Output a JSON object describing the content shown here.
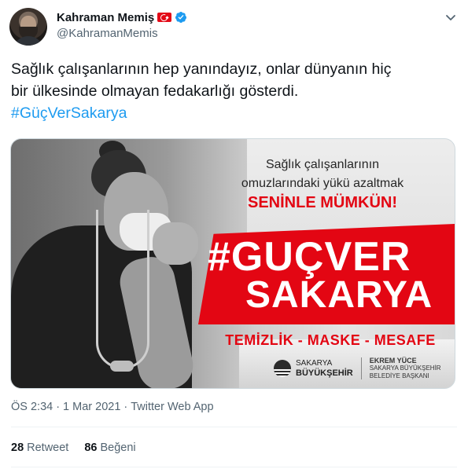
{
  "author": {
    "name": "Kahraman Memiş",
    "handle": "@KahramanMemis",
    "flag_icon": "turkey-flag-icon",
    "verified_icon": "verified-badge-icon"
  },
  "tweet": {
    "line1": "Sağlık çalışanlarının hep yanındayız, onlar dünyanın hiç",
    "line2": "bir ülkesinde olmayan fedakarlığı gösterdi.",
    "hashtag": "#GüçVerSakarya"
  },
  "media": {
    "line1": "Sağlık çalışanlarının",
    "line2": "omuzlarındaki yükü azaltmak",
    "line3": "SENİNLE MÜMKÜN!",
    "hash1": "#GUÇVER",
    "hash2": "SAKARYA",
    "tagline": "TEMİZLİK - MASKE - MESAFE",
    "logo_line1": "SAKARYA",
    "logo_line2": "BÜYÜKŞEHİR",
    "mayor_name": "EKREM YÜCE",
    "mayor_title1": "SAKARYA BÜYÜKŞEHİR",
    "mayor_title2": "BELEDİYE BAŞKANI"
  },
  "meta": {
    "time": "ÖS 2:34",
    "sep1": "·",
    "date": "1 Mar 2021",
    "sep2": "·",
    "source": "Twitter Web App"
  },
  "stats": {
    "retweets_count": "28",
    "retweets_label": "Retweet",
    "likes_count": "86",
    "likes_label": "Beğeni"
  },
  "colors": {
    "link": "#1d9bf0",
    "secondary_text": "#536471",
    "campaign_red": "#e30613"
  }
}
